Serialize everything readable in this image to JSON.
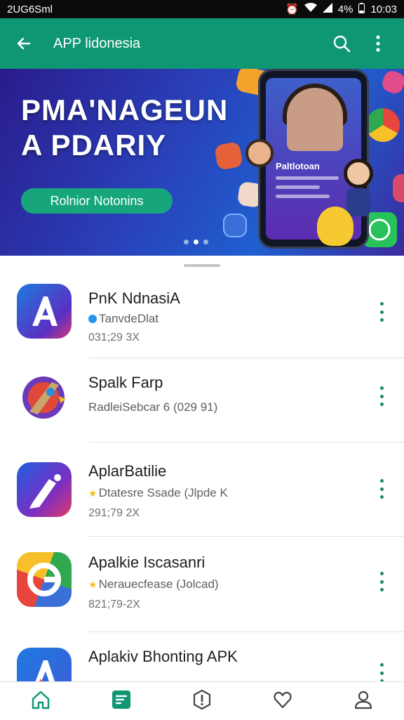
{
  "status_bar": {
    "carrier": "2UG6Sml",
    "battery": "4%",
    "time": "10:03"
  },
  "app_bar": {
    "title": "APP lidonesia"
  },
  "banner": {
    "headline_line1": "PMA'NAGEUN",
    "headline_line2": "A PDARIY",
    "cta_label": "Rolnior Notonins",
    "phone_text": "Paltlotoan",
    "dots": 3,
    "active_dot": 1
  },
  "apps": [
    {
      "name": "PnK NdnasiA",
      "subtitle": "TanvdeDlat",
      "meta": "031;29 3X",
      "icon": "letter-a-app-icon",
      "badge": "blue-dot"
    },
    {
      "name": "Spalk Farp",
      "subtitle": "RadleiSebcar 6 (029 91)",
      "meta": "",
      "icon": "rocket-app-icon",
      "badge": ""
    },
    {
      "name": "AplarBatilie",
      "subtitle": "Dtatesre Ssade (Jlpde K",
      "meta": "291;79 2X",
      "icon": "pencil-app-icon",
      "badge": "star"
    },
    {
      "name": "Apalkie Iscasanri",
      "subtitle": "Nerauecfease (Jolcad)",
      "meta": "821;79-2X",
      "icon": "google-g-app-icon",
      "badge": "star"
    },
    {
      "name": "Aplakiv Bhonting APK",
      "subtitle": "",
      "meta": "",
      "icon": "letter-a-app-icon",
      "badge": ""
    }
  ],
  "bottom_nav": [
    {
      "id": "home",
      "icon": "home-icon"
    },
    {
      "id": "apps",
      "icon": "apps-icon",
      "active": true
    },
    {
      "id": "info",
      "icon": "info-icon"
    },
    {
      "id": "favorites",
      "icon": "heart-icon"
    },
    {
      "id": "profile",
      "icon": "profile-icon"
    }
  ],
  "colors": {
    "primary": "#0f9672",
    "accent": "#17a67b",
    "menu_dots": "#1b8a6b"
  }
}
